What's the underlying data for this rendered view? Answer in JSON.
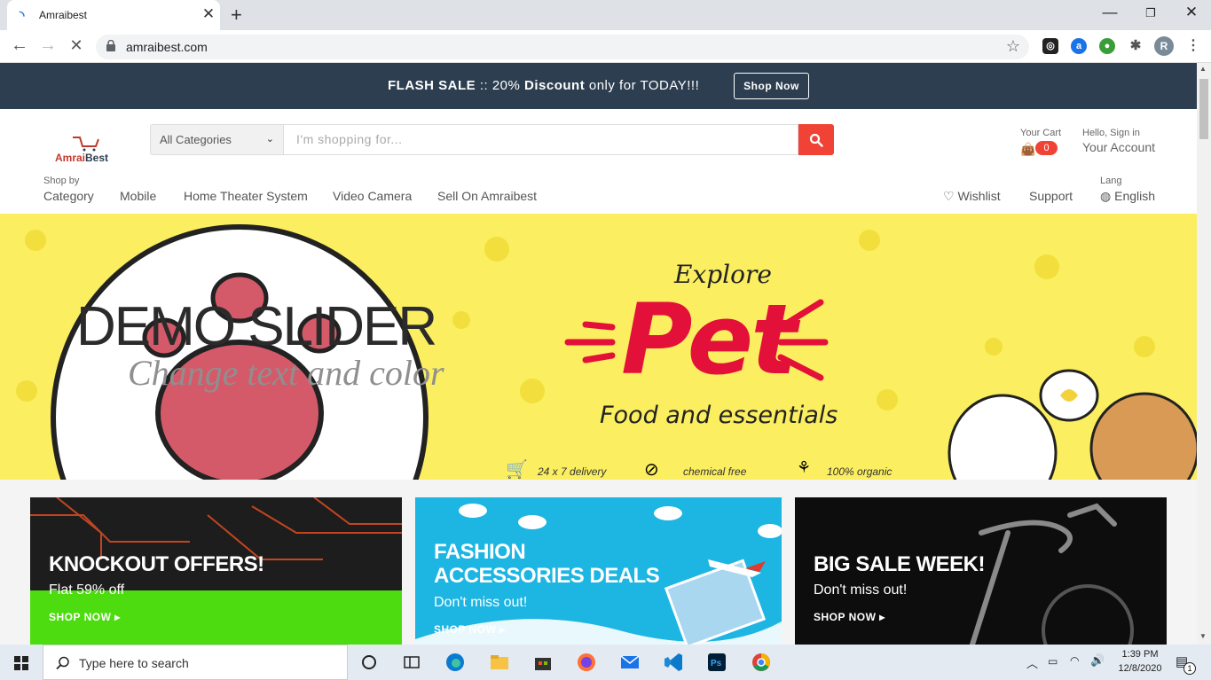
{
  "browser": {
    "tab_title": "Amraibest",
    "url": "amraibest.com",
    "profile_initial": "R"
  },
  "flash": {
    "label": "FLASH SALE",
    "separator": " :: 20% ",
    "discount": "Discount",
    "rest": " only for TODAY!!!",
    "button": "Shop Now"
  },
  "header": {
    "logo_brand_a": "Amrai",
    "logo_brand_b": "Best",
    "category_select": "All Categories",
    "search_placeholder": "I'm shopping for...",
    "cart_label": "Your Cart",
    "cart_count": "0",
    "hello": "Hello, Sign in",
    "account": "Your Account"
  },
  "nav": {
    "shop_by": "Shop by",
    "category": "Category",
    "mobile": "Mobile",
    "home_theater": "Home Theater System",
    "video_camera": "Video Camera",
    "sell": "Sell On Amraibest",
    "wishlist": "Wishlist",
    "support": "Support",
    "lang_label": "Lang",
    "language": "English"
  },
  "slider": {
    "title": "DEMO SLIDER",
    "subtitle": "Change text and color",
    "explore": "Explore",
    "pet": "Pet",
    "food": "Food and essentials",
    "feat1": "24 x 7 delivery",
    "feat2": "chemical free",
    "feat3": "100% organic"
  },
  "banners": {
    "b1_title": "KNOCKOUT OFFERS!",
    "b1_sub": "Flat 59% off",
    "b1_link": "SHOP NOW",
    "b2_title_1": "FASHION",
    "b2_title_2": "ACCESSORIES DEALS",
    "b2_sub": "Don't miss out!",
    "b2_link": "SHOP NOW",
    "b3_title": "BIG SALE WEEK!",
    "b3_sub": "Don't miss out!",
    "b3_link": "SHOP NOW"
  },
  "taskbar": {
    "search_text": "Type here to search",
    "time": "1:39 PM",
    "date": "12/8/2020",
    "notification_count": "1"
  }
}
